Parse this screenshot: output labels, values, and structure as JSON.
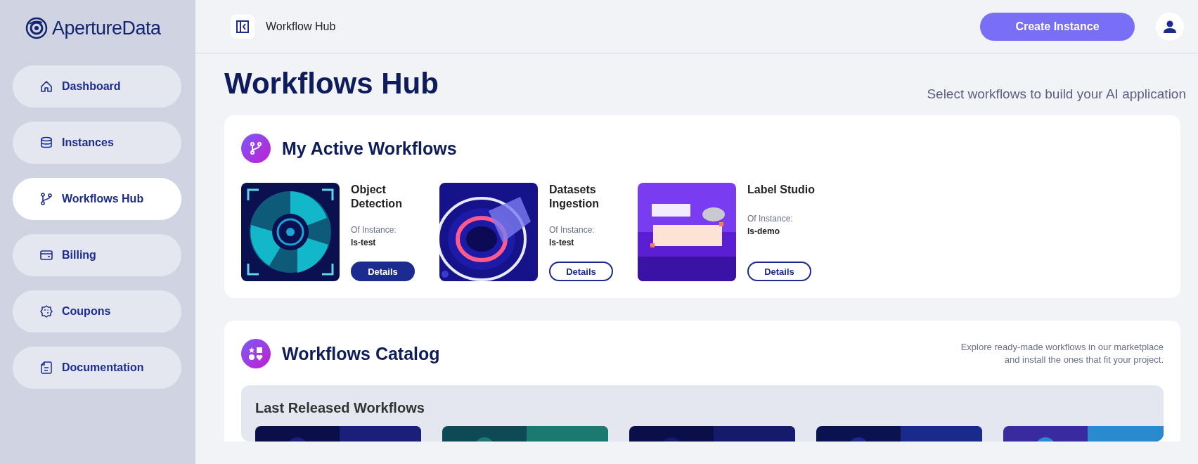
{
  "brand": {
    "name": "ApertureData"
  },
  "sidebar": {
    "items": [
      {
        "label": "Dashboard",
        "selected": false
      },
      {
        "label": "Instances",
        "selected": false
      },
      {
        "label": "Workflows Hub",
        "selected": true
      },
      {
        "label": "Billing",
        "selected": false
      },
      {
        "label": "Coupons",
        "selected": false
      },
      {
        "label": "Documentation",
        "selected": false
      }
    ]
  },
  "header": {
    "breadcrumb": "Workflow Hub",
    "create_button": "Create Instance"
  },
  "page": {
    "title": "Workflows Hub",
    "subtitle": "Select workflows to build your AI application"
  },
  "active_workflows": {
    "title": "My Active Workflows",
    "items": [
      {
        "name": "Object Detection",
        "instance_label": "Of Instance:",
        "instance": "ls-test",
        "button": "Details",
        "selected": true
      },
      {
        "name": "Datasets Ingestion",
        "instance_label": "Of Instance:",
        "instance": "ls-test",
        "button": "Details",
        "selected": false
      },
      {
        "name": "Label Studio",
        "instance_label": "Of Instance:",
        "instance": "ls-demo",
        "button": "Details",
        "selected": false
      }
    ]
  },
  "catalog": {
    "title": "Workflows Catalog",
    "description": "Explore ready-made workflows in our marketplace\nand install the ones that fit your project.",
    "section_title": "Last Released Workflows"
  }
}
